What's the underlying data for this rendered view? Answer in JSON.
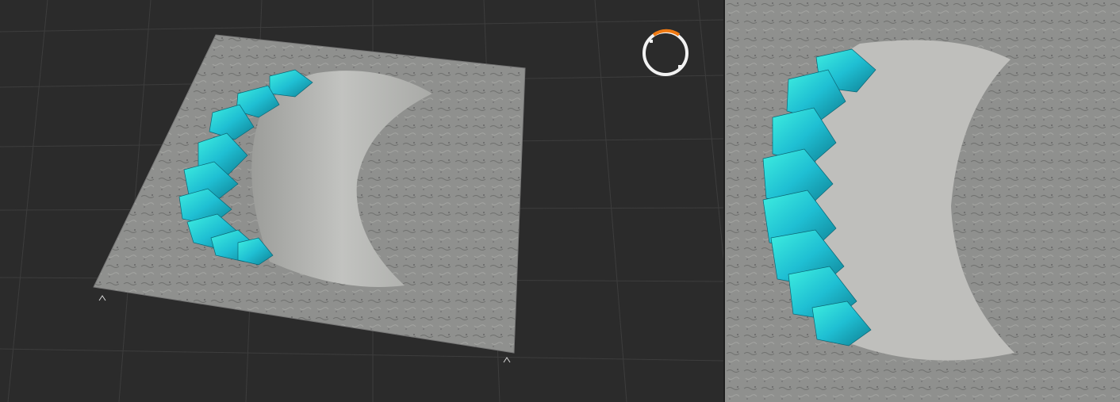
{
  "scene": {
    "viewport": {
      "background_color": "#2b2b2b",
      "grid_color": "#3d3d3d",
      "terrain_color": "#8f908e",
      "basin_color": "#b8b9b6",
      "crystal_color": "#22c3d6",
      "crystal_highlight_color": "#3ff0e0"
    },
    "view_compass": {
      "icon": "orbit-compass-icon",
      "ring_color": "#f2f2f2",
      "accent_color": "#f07a12"
    },
    "corner_markers": {
      "icon": "corner-marker-icon",
      "color": "#d8d8d8"
    },
    "top_preview": {
      "terrain_color": "#8b8c8a",
      "basin_color": "#bfbfbc",
      "crystal_color": "#1fc0d4"
    }
  }
}
